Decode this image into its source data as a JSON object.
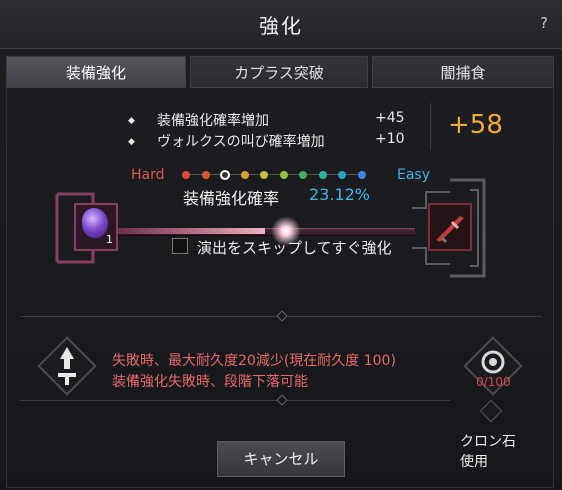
{
  "window": {
    "title": "強化",
    "help": "?"
  },
  "tabs": [
    {
      "label": "装備強化",
      "active": true
    },
    {
      "label": "カプラス突破",
      "active": false
    },
    {
      "label": "闇捕食",
      "active": false
    }
  ],
  "bonuses": [
    {
      "label": "装備強化確率増加",
      "value": "+45"
    },
    {
      "label": "ヴォルクスの叫び確率増加",
      "value": "+10"
    }
  ],
  "bonus_total": "+58",
  "difficulty": {
    "hard_label": "Hard",
    "easy_label": "Easy",
    "dot_colors": [
      "#e04a3c",
      "#d8583a",
      "#f0f0f0",
      "#d8a030",
      "#c8c040",
      "#8cc040",
      "#40b060",
      "#30b0a0",
      "#30a0c0",
      "#3a8ae0"
    ],
    "selected_index": 2
  },
  "rate": {
    "label": "装備強化確率",
    "value": "23.12%",
    "fraction": 0.5
  },
  "material": {
    "quantity": "1"
  },
  "skip": {
    "label": "演出をスキップしてすぐ強化",
    "checked": false
  },
  "warnings": [
    "失敗時、最大耐久度20減少(現在耐久度 100)",
    "装備強化失敗時、段階下落可能"
  ],
  "clone": {
    "count": "0/100",
    "label_line1": "クロン石",
    "label_line2": "使用"
  },
  "buttons": {
    "cancel": "キャンセル"
  },
  "colors": {
    "accent_orange": "#f2a93b",
    "accent_blue": "#3fb4e8",
    "warning_red": "#e8686a"
  }
}
